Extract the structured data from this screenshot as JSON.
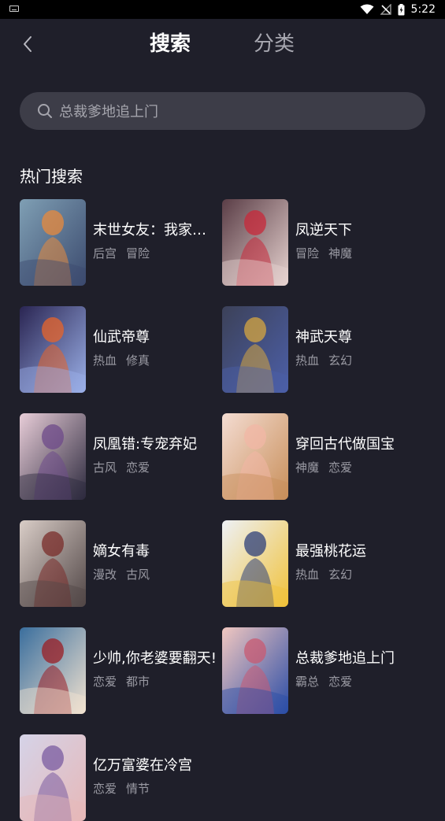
{
  "status_bar": {
    "time": "5:22"
  },
  "header": {
    "tabs": [
      {
        "label": "搜索"
      },
      {
        "label": "分类"
      }
    ]
  },
  "search": {
    "placeholder": "总裁爹地追上门"
  },
  "section": {
    "title": "热门搜索"
  },
  "items": [
    {
      "title": "末世女友：我家后…",
      "tags": [
        "后宫",
        "冒险"
      ],
      "palette": [
        "#7f9fb4",
        "#e88a3c",
        "#3b4a6e"
      ]
    },
    {
      "title": "凤逆天下",
      "tags": [
        "冒险",
        "神魔"
      ],
      "palette": [
        "#5a3d46",
        "#c8283a",
        "#e7d3d0"
      ]
    },
    {
      "title": "仙武帝尊",
      "tags": [
        "热血",
        "修真"
      ],
      "palette": [
        "#2a2552",
        "#e8642a",
        "#9bb0e8"
      ]
    },
    {
      "title": "神武天尊",
      "tags": [
        "热血",
        "玄幻"
      ],
      "palette": [
        "#3c4158",
        "#d6a640",
        "#4c5fa8"
      ]
    },
    {
      "title": "凤凰错:专宠弃妃",
      "tags": [
        "古风",
        "恋爱"
      ],
      "palette": [
        "#e8cdd8",
        "#6d4a8a",
        "#2d2a3e"
      ]
    },
    {
      "title": "穿回古代做国宝",
      "tags": [
        "神魔",
        "恋爱"
      ],
      "palette": [
        "#f4dcd2",
        "#f2b7a6",
        "#c88f5a"
      ]
    },
    {
      "title": "嫡女有毒",
      "tags": [
        "漫改",
        "古风"
      ],
      "palette": [
        "#d9cdc7",
        "#7a2c2a",
        "#514646"
      ]
    },
    {
      "title": "最强桃花运",
      "tags": [
        "热血",
        "玄幻"
      ],
      "palette": [
        "#eef1f6",
        "#2e3f7a",
        "#f0c23a"
      ]
    },
    {
      "title": "少帅,你老婆要翻天!",
      "tags": [
        "恋爱",
        "都市"
      ],
      "palette": [
        "#3a6e9d",
        "#9b1e24",
        "#f1e2d0"
      ]
    },
    {
      "title": "总裁爹地追上门",
      "tags": [
        "霸总",
        "恋爱"
      ],
      "palette": [
        "#f1c7c0",
        "#c85a72",
        "#2b4da6"
      ]
    },
    {
      "title": "亿万富婆在冷宫",
      "tags": [
        "恋爱",
        "情节"
      ],
      "palette": [
        "#d5d3e8",
        "#7a5ba0",
        "#e6b8b8"
      ]
    }
  ]
}
